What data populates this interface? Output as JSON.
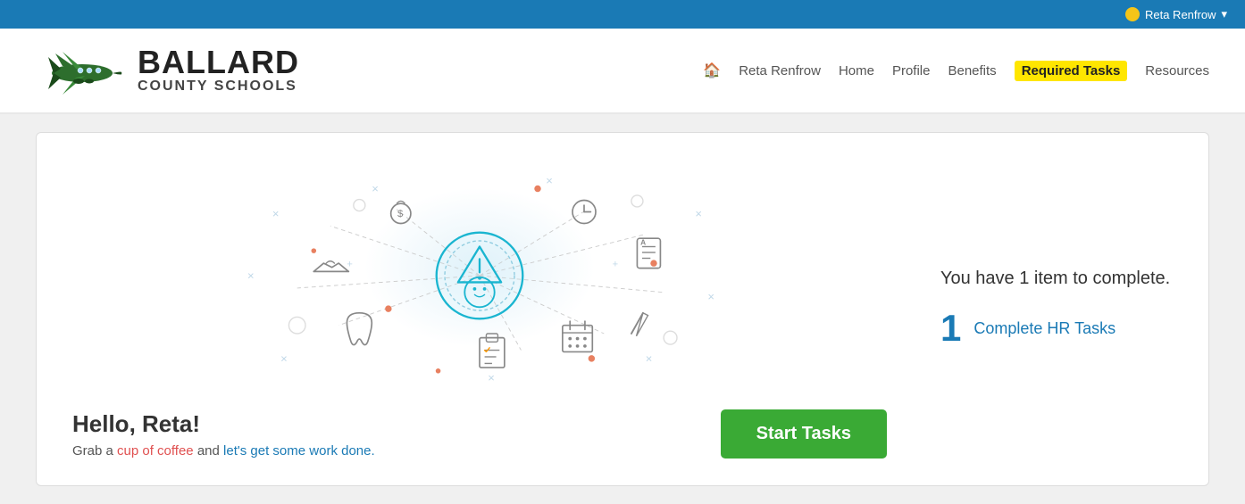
{
  "topbar": {
    "user": "Reta Renfrow",
    "dropdown_icon": "▾"
  },
  "header": {
    "logo": {
      "brand_name": "BALLARD",
      "subtitle": "COUNTY SCHOOLS"
    },
    "nav": {
      "home_icon": "🏠",
      "user_link": "Reta Renfrow",
      "items": [
        {
          "label": "Home",
          "id": "home",
          "active": false
        },
        {
          "label": "Profile",
          "id": "profile",
          "active": false
        },
        {
          "label": "Benefits",
          "id": "benefits",
          "active": false
        },
        {
          "label": "Required Tasks",
          "id": "required-tasks",
          "active": true
        },
        {
          "label": "Resources",
          "id": "resources",
          "active": false
        }
      ]
    }
  },
  "main": {
    "item_count_text": "You have 1 item to complete.",
    "task_number": "1",
    "task_link": "Complete HR Tasks",
    "greeting_name": "Hello, Reta!",
    "greeting_sub": "Grab a cup of coffee and let's get some work done.",
    "start_button": "Start Tasks"
  }
}
